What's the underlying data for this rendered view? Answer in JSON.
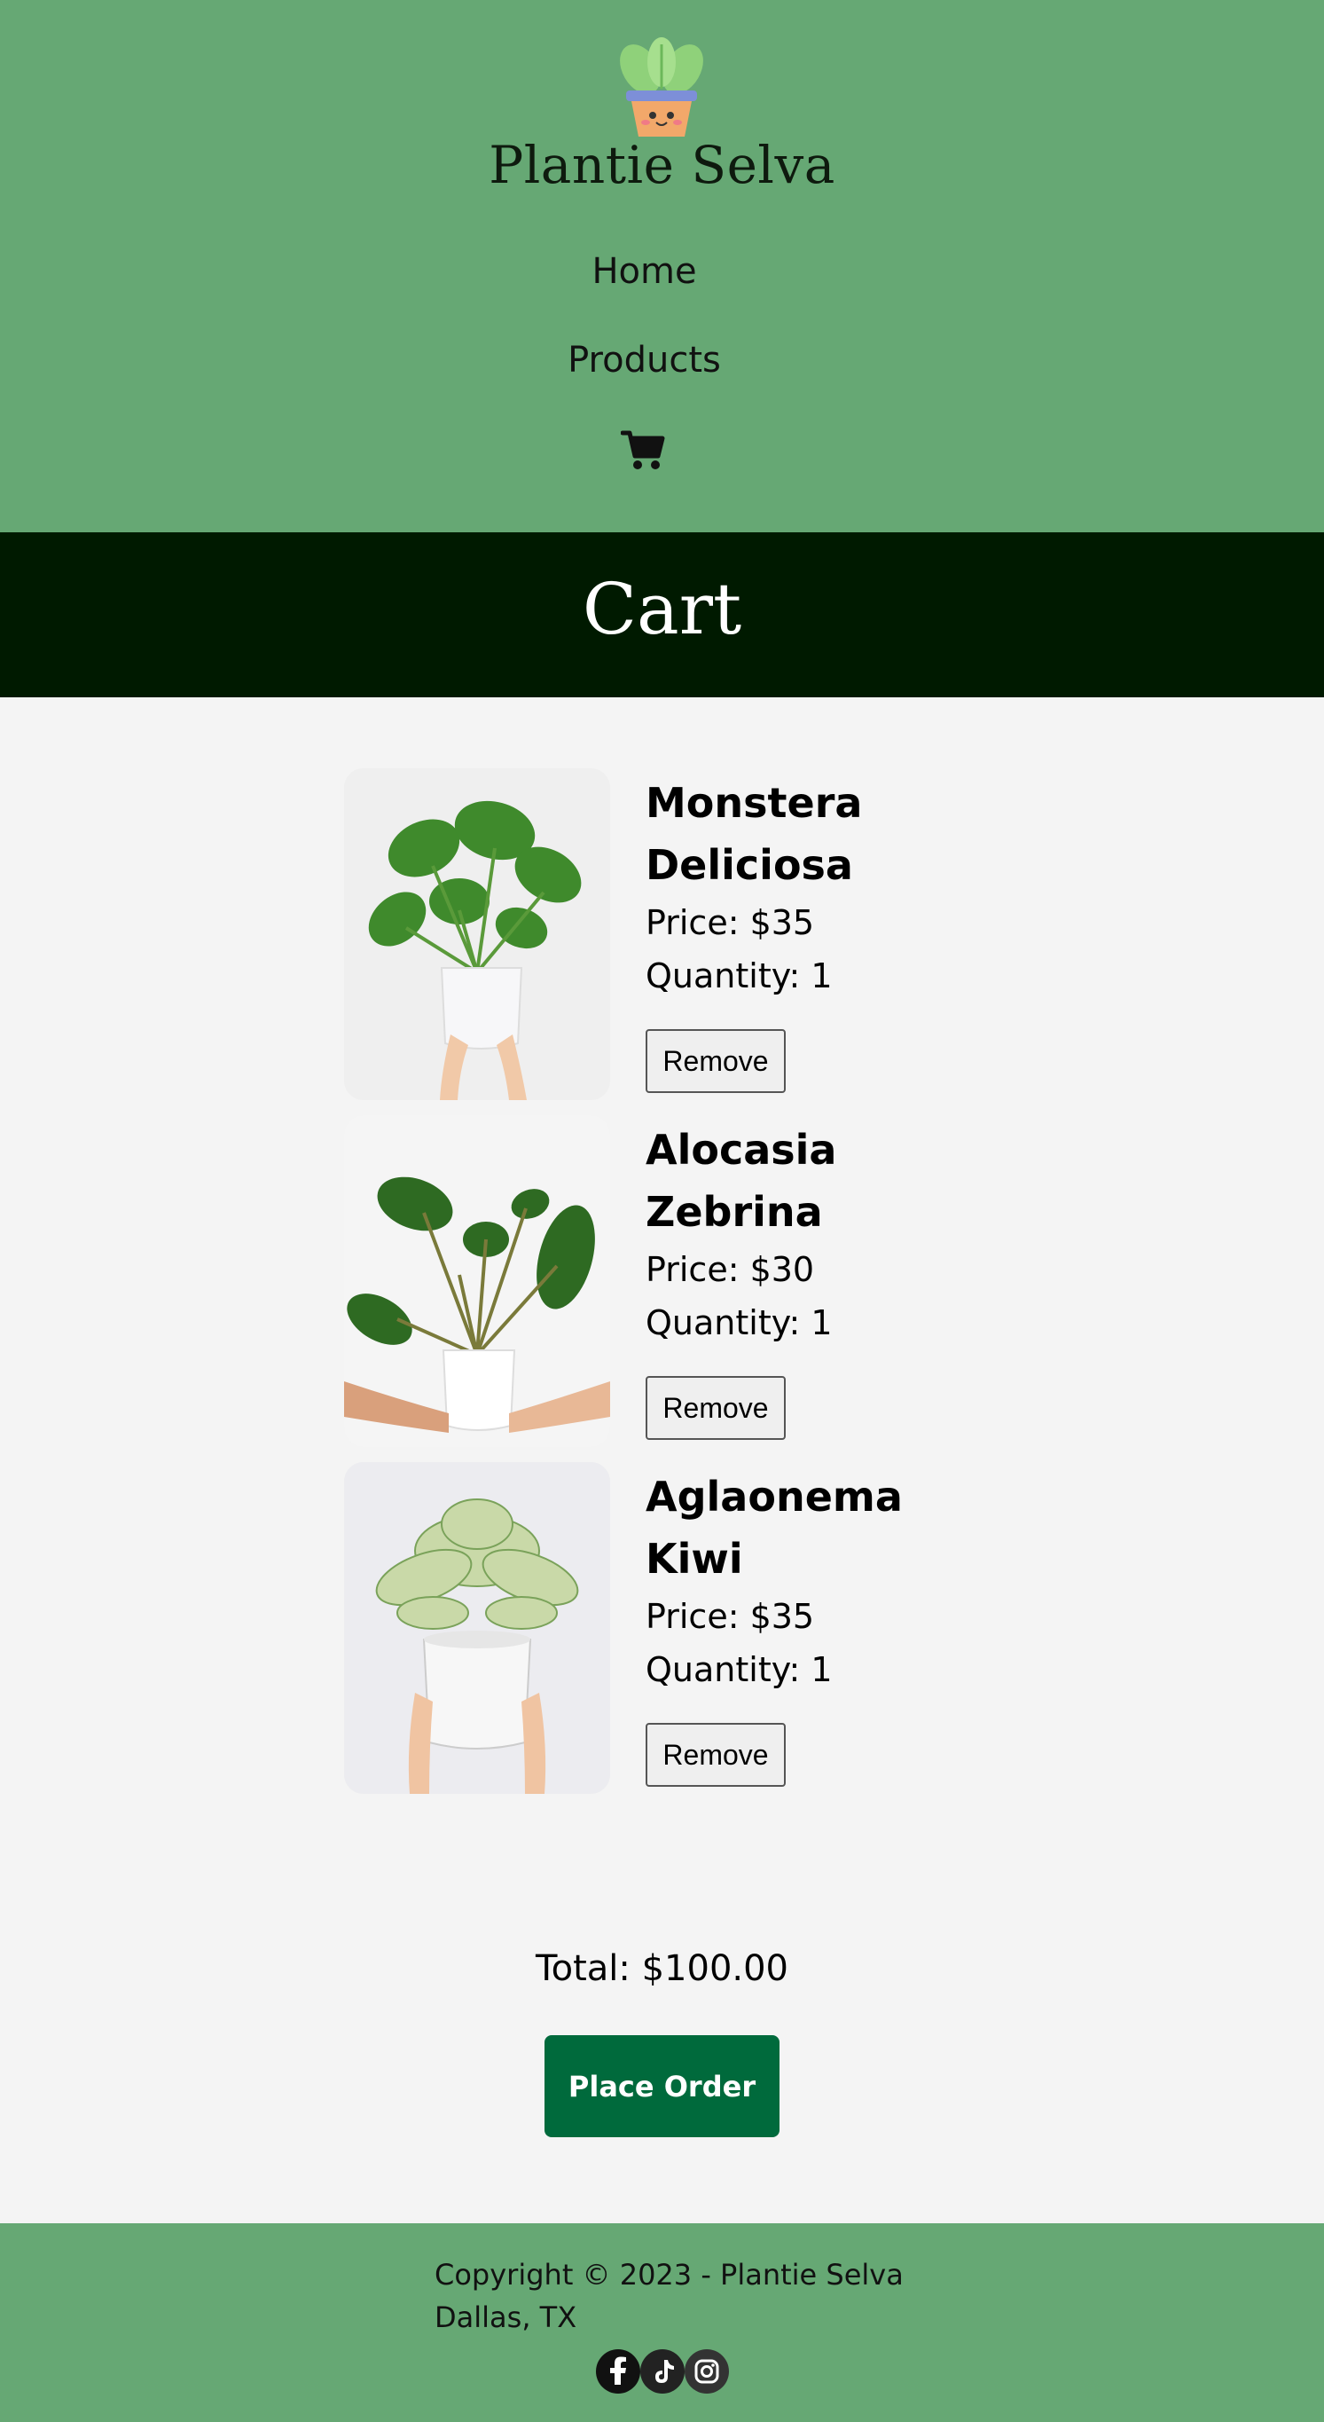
{
  "header": {
    "brand": "Plantie Selva",
    "nav": [
      "Home",
      "Products"
    ],
    "cart_icon": "cart-icon",
    "background": "#66a874"
  },
  "banner": {
    "title": "Cart",
    "background": "#001a00"
  },
  "cart": {
    "items": [
      {
        "name": "Monstera Deliciosa",
        "price": "Price: $35",
        "quantity": "Quantity: 1",
        "remove_label": "Remove",
        "image": "monstera-plant-image"
      },
      {
        "name": "Alocasia Zebrina",
        "price": "Price: $30",
        "quantity": "Quantity: 1",
        "remove_label": "Remove",
        "image": "alocasia-plant-image"
      },
      {
        "name": "Aglaonema Kiwi",
        "price": "Price: $35",
        "quantity": "Quantity: 1",
        "remove_label": "Remove",
        "image": "aglaonema-plant-image"
      }
    ],
    "total": "Total: $100.00",
    "place_order_label": "Place Order",
    "accent": "#006a3c"
  },
  "footer": {
    "copyright": "Copyright © 2023 - Plantie Selva",
    "location": "Dallas, TX",
    "social_icons": [
      "facebook-icon",
      "tiktok-icon",
      "instagram-icon"
    ]
  }
}
